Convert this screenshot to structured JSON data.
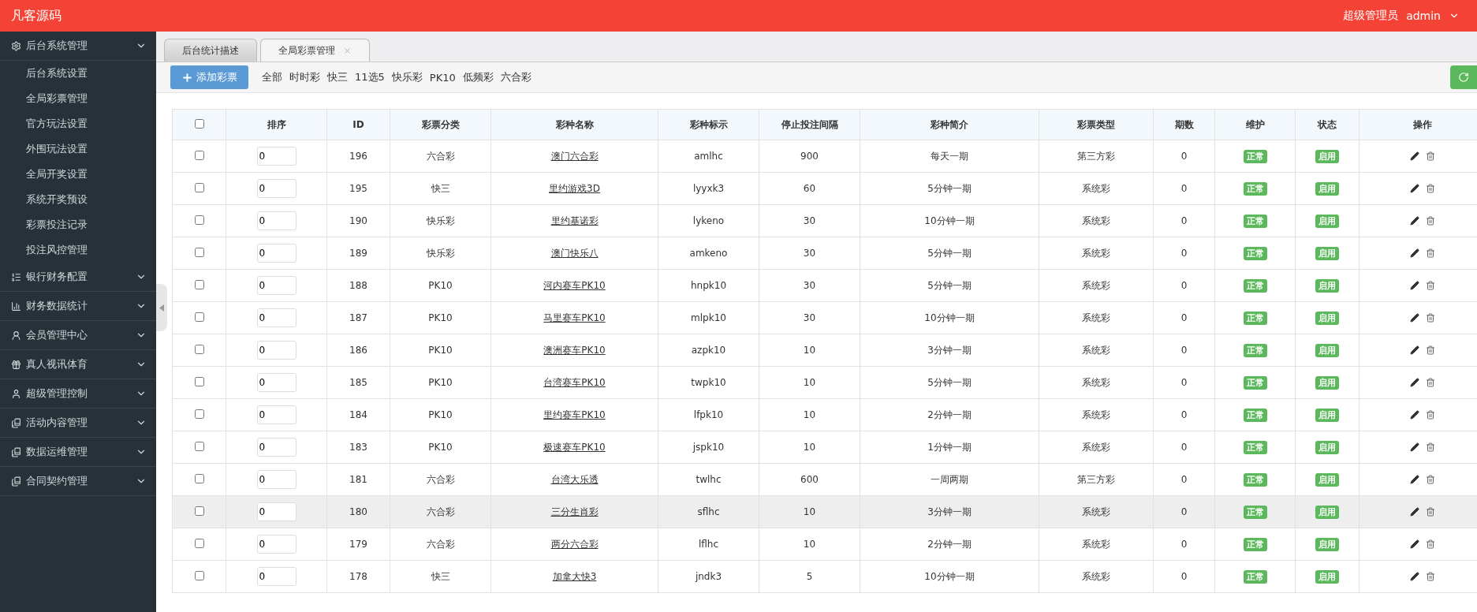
{
  "header": {
    "brand": "凡客源码",
    "role": "超级管理员",
    "user": "admin"
  },
  "sidebar": [
    {
      "label": "后台系统管理",
      "children": [
        {
          "label": "后台系统设置"
        },
        {
          "label": "全局彩票管理"
        },
        {
          "label": "官方玩法设置"
        },
        {
          "label": "外围玩法设置"
        },
        {
          "label": "全局开奖设置"
        },
        {
          "label": "系统开奖预设"
        },
        {
          "label": "彩票投注记录"
        },
        {
          "label": "投注风控管理"
        }
      ]
    },
    {
      "label": "银行财务配置"
    },
    {
      "label": "财务数据统计"
    },
    {
      "label": "会员管理中心"
    },
    {
      "label": "真人视讯体育"
    },
    {
      "label": "超级管理控制"
    },
    {
      "label": "活动内容管理"
    },
    {
      "label": "数据运维管理"
    },
    {
      "label": "合同契约管理"
    }
  ],
  "tabs": [
    {
      "label": "后台统计描述",
      "selected": false,
      "closable": false
    },
    {
      "label": "全局彩票管理",
      "selected": true,
      "closable": true
    }
  ],
  "toolbar": {
    "add_button": "添加彩票",
    "filters": [
      "全部",
      "时时彩",
      "快三",
      "11选5",
      "快乐彩",
      "PK10",
      "低频彩",
      "六合彩"
    ]
  },
  "table": {
    "all_checked": false,
    "columns": [
      "排序",
      "ID",
      "彩票分类",
      "彩种名称",
      "彩种标示",
      "停止投注间隔",
      "彩种简介",
      "彩票类型",
      "期数",
      "维护",
      "状态",
      "操作"
    ],
    "rows": [
      {
        "checked": false,
        "hovered": false,
        "sort": "0",
        "id": "196",
        "category": "六合彩",
        "name": "澳门六合彩",
        "code": "amlhc",
        "interval": "900",
        "intro": "每天一期",
        "type": "第三方彩",
        "periods": "0",
        "maintenance": "正常",
        "status": "启用"
      },
      {
        "checked": false,
        "hovered": false,
        "sort": "0",
        "id": "195",
        "category": "快三",
        "name": "里约游戏3D",
        "code": "lyyxk3",
        "interval": "60",
        "intro": "5分钟一期",
        "type": "系统彩",
        "periods": "0",
        "maintenance": "正常",
        "status": "启用"
      },
      {
        "checked": false,
        "hovered": false,
        "sort": "0",
        "id": "190",
        "category": "快乐彩",
        "name": "里约基诺彩",
        "code": "lykeno",
        "interval": "30",
        "intro": "10分钟一期",
        "type": "系统彩",
        "periods": "0",
        "maintenance": "正常",
        "status": "启用"
      },
      {
        "checked": false,
        "hovered": false,
        "sort": "0",
        "id": "189",
        "category": "快乐彩",
        "name": "澳门快乐八",
        "code": "amkeno",
        "interval": "30",
        "intro": "5分钟一期",
        "type": "系统彩",
        "periods": "0",
        "maintenance": "正常",
        "status": "启用"
      },
      {
        "checked": false,
        "hovered": false,
        "sort": "0",
        "id": "188",
        "category": "PK10",
        "name": "河内赛车PK10",
        "code": "hnpk10",
        "interval": "30",
        "intro": "5分钟一期",
        "type": "系统彩",
        "periods": "0",
        "maintenance": "正常",
        "status": "启用"
      },
      {
        "checked": false,
        "hovered": false,
        "sort": "0",
        "id": "187",
        "category": "PK10",
        "name": "马里赛车PK10",
        "code": "mlpk10",
        "interval": "30",
        "intro": "10分钟一期",
        "type": "系统彩",
        "periods": "0",
        "maintenance": "正常",
        "status": "启用"
      },
      {
        "checked": false,
        "hovered": false,
        "sort": "0",
        "id": "186",
        "category": "PK10",
        "name": "澳洲赛车PK10",
        "code": "azpk10",
        "interval": "10",
        "intro": "3分钟一期",
        "type": "系统彩",
        "periods": "0",
        "maintenance": "正常",
        "status": "启用"
      },
      {
        "checked": false,
        "hovered": false,
        "sort": "0",
        "id": "185",
        "category": "PK10",
        "name": "台湾赛车PK10",
        "code": "twpk10",
        "interval": "10",
        "intro": "5分钟一期",
        "type": "系统彩",
        "periods": "0",
        "maintenance": "正常",
        "status": "启用"
      },
      {
        "checked": false,
        "hovered": false,
        "sort": "0",
        "id": "184",
        "category": "PK10",
        "name": "里约赛车PK10",
        "code": "lfpk10",
        "interval": "10",
        "intro": "2分钟一期",
        "type": "系统彩",
        "periods": "0",
        "maintenance": "正常",
        "status": "启用"
      },
      {
        "checked": false,
        "hovered": false,
        "sort": "0",
        "id": "183",
        "category": "PK10",
        "name": "极速赛车PK10",
        "code": "jspk10",
        "interval": "10",
        "intro": "1分钟一期",
        "type": "系统彩",
        "periods": "0",
        "maintenance": "正常",
        "status": "启用"
      },
      {
        "checked": false,
        "hovered": false,
        "sort": "0",
        "id": "181",
        "category": "六合彩",
        "name": "台湾大乐透",
        "code": "twlhc",
        "interval": "600",
        "intro": "一周两期",
        "type": "第三方彩",
        "periods": "0",
        "maintenance": "正常",
        "status": "启用"
      },
      {
        "checked": false,
        "hovered": true,
        "sort": "0",
        "id": "180",
        "category": "六合彩",
        "name": "三分生肖彩",
        "code": "sflhc",
        "interval": "10",
        "intro": "3分钟一期",
        "type": "系统彩",
        "periods": "0",
        "maintenance": "正常",
        "status": "启用"
      },
      {
        "checked": false,
        "hovered": false,
        "sort": "0",
        "id": "179",
        "category": "六合彩",
        "name": "两分六合彩",
        "code": "lflhc",
        "interval": "10",
        "intro": "2分钟一期",
        "type": "系统彩",
        "periods": "0",
        "maintenance": "正常",
        "status": "启用"
      },
      {
        "checked": false,
        "hovered": false,
        "sort": "0",
        "id": "178",
        "category": "快三",
        "name": "加拿大快3",
        "code": "jndk3",
        "interval": "5",
        "intro": "10分钟一期",
        "type": "系统彩",
        "periods": "0",
        "maintenance": "正常",
        "status": "启用"
      }
    ]
  }
}
